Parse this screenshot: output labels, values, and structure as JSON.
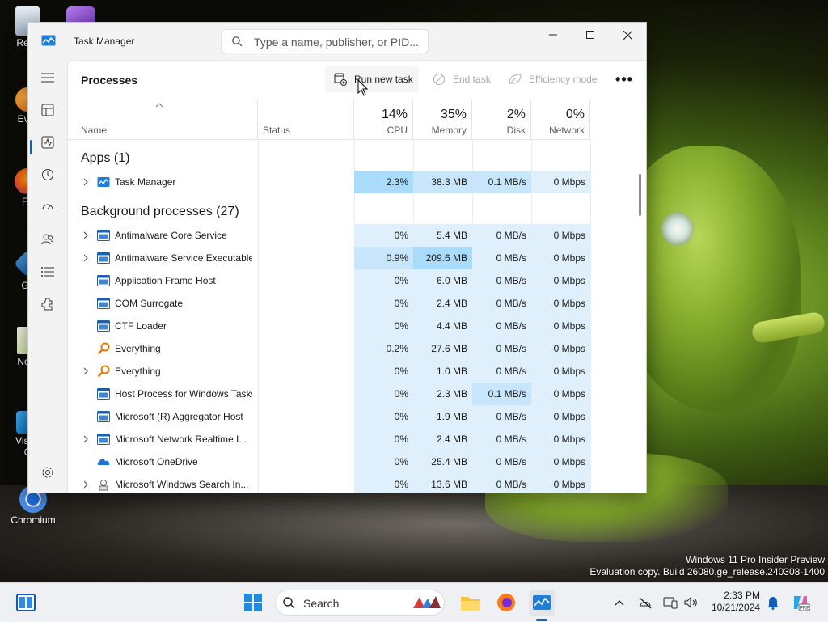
{
  "desktop": {
    "icons": [
      {
        "label": "Recy",
        "icon": "recycle-bin-icon"
      },
      {
        "label": "Ever",
        "icon": "everything-icon"
      },
      {
        "label": "Fir",
        "icon": "firefox-icon"
      },
      {
        "label": "Git",
        "icon": "git-icon"
      },
      {
        "label": "Note",
        "icon": "notepad-icon"
      },
      {
        "label": "Visua",
        "icon": "vscode-icon"
      },
      {
        "label": "C",
        "icon": "vscode-icon"
      },
      {
        "label": "Chromium",
        "icon": "chromium-icon"
      }
    ],
    "watermark": {
      "line1": "Windows 11 Pro Insider Preview",
      "line2": "Evaluation copy. Build 26080.ge_release.240308-1400"
    }
  },
  "window": {
    "title": "Task Manager",
    "search_placeholder": "Type a name, publisher, or PID...",
    "controls": [
      "minimize",
      "maximize",
      "close"
    ]
  },
  "nav": {
    "items": [
      {
        "name": "menu",
        "icon": "hamburger-icon"
      },
      {
        "name": "processes",
        "icon": "processes-icon",
        "selected": true
      },
      {
        "name": "performance",
        "icon": "performance-icon"
      },
      {
        "name": "app-history",
        "icon": "history-icon"
      },
      {
        "name": "startup-apps",
        "icon": "startup-icon"
      },
      {
        "name": "users",
        "icon": "users-icon"
      },
      {
        "name": "details",
        "icon": "details-icon"
      },
      {
        "name": "services",
        "icon": "services-icon"
      },
      {
        "name": "settings",
        "icon": "settings-icon"
      }
    ]
  },
  "page": {
    "title": "Processes",
    "commands": {
      "run_new_task": "Run new task",
      "end_task": "End task",
      "efficiency_mode": "Efficiency mode",
      "more": "•••"
    }
  },
  "columns": {
    "name": "Name",
    "status": "Status",
    "cpu": {
      "pct": "14%",
      "label": "CPU"
    },
    "memory": {
      "pct": "35%",
      "label": "Memory"
    },
    "disk": {
      "pct": "2%",
      "label": "Disk"
    },
    "network": {
      "pct": "0%",
      "label": "Network"
    }
  },
  "groups": {
    "apps": "Apps (1)",
    "background": "Background processes (27)"
  },
  "apps": [
    {
      "name": "Task Manager",
      "icon": "task-manager-icon",
      "expandable": true,
      "cpu": "2.3%",
      "memory": "38.3 MB",
      "disk": "0.1 MB/s",
      "network": "0 Mbps"
    }
  ],
  "background": [
    {
      "name": "Antimalware Core Service",
      "icon": "service-window-icon",
      "expandable": true,
      "cpu": "0%",
      "memory": "5.4 MB",
      "disk": "0 MB/s",
      "network": "0 Mbps"
    },
    {
      "name": "Antimalware Service Executable",
      "icon": "service-window-icon",
      "expandable": true,
      "cpu": "0.9%",
      "memory": "209.6 MB",
      "disk": "0 MB/s",
      "network": "0 Mbps"
    },
    {
      "name": "Application Frame Host",
      "icon": "service-window-icon",
      "expandable": false,
      "cpu": "0%",
      "memory": "6.0 MB",
      "disk": "0 MB/s",
      "network": "0 Mbps"
    },
    {
      "name": "COM Surrogate",
      "icon": "service-window-icon",
      "expandable": false,
      "cpu": "0%",
      "memory": "2.4 MB",
      "disk": "0 MB/s",
      "network": "0 Mbps"
    },
    {
      "name": "CTF Loader",
      "icon": "service-window-icon",
      "expandable": false,
      "cpu": "0%",
      "memory": "4.4 MB",
      "disk": "0 MB/s",
      "network": "0 Mbps"
    },
    {
      "name": "Everything",
      "icon": "everything-icon",
      "expandable": false,
      "cpu": "0.2%",
      "memory": "27.6 MB",
      "disk": "0 MB/s",
      "network": "0 Mbps"
    },
    {
      "name": "Everything",
      "icon": "everything-icon",
      "expandable": true,
      "cpu": "0%",
      "memory": "1.0 MB",
      "disk": "0 MB/s",
      "network": "0 Mbps"
    },
    {
      "name": "Host Process for Windows Tasks",
      "icon": "service-window-icon",
      "expandable": false,
      "cpu": "0%",
      "memory": "2.3 MB",
      "disk": "0.1 MB/s",
      "network": "0 Mbps"
    },
    {
      "name": "Microsoft (R) Aggregator Host",
      "icon": "service-window-icon",
      "expandable": false,
      "cpu": "0%",
      "memory": "1.9 MB",
      "disk": "0 MB/s",
      "network": "0 Mbps"
    },
    {
      "name": "Microsoft Network Realtime I...",
      "icon": "service-window-icon",
      "expandable": true,
      "cpu": "0%",
      "memory": "2.4 MB",
      "disk": "0 MB/s",
      "network": "0 Mbps"
    },
    {
      "name": "Microsoft OneDrive",
      "icon": "onedrive-icon",
      "expandable": false,
      "cpu": "0%",
      "memory": "25.4 MB",
      "disk": "0 MB/s",
      "network": "0 Mbps"
    },
    {
      "name": "Microsoft Windows Search In...",
      "icon": "search-indexer-icon",
      "expandable": true,
      "cpu": "0%",
      "memory": "13.6 MB",
      "disk": "0 MB/s",
      "network": "0 Mbps"
    }
  ],
  "taskbar": {
    "search_label": "Search",
    "pinned": [
      "widgets-icon",
      "start-icon",
      "copilot-art-icon",
      "file-explorer-icon",
      "firefox-icon",
      "task-manager-icon"
    ],
    "tray": [
      "chevron-up-icon",
      "network-off-icon",
      "display-icon",
      "volume-icon",
      "notification-bell-icon",
      "copilot-icon"
    ],
    "time": "2:33 PM",
    "date": "10/21/2024"
  },
  "colors": {
    "accent": "#0067c0",
    "heat_light": "#dff0fc",
    "heat_mid": "#c7e6fb",
    "heat_strong": "#a9dbfa"
  }
}
